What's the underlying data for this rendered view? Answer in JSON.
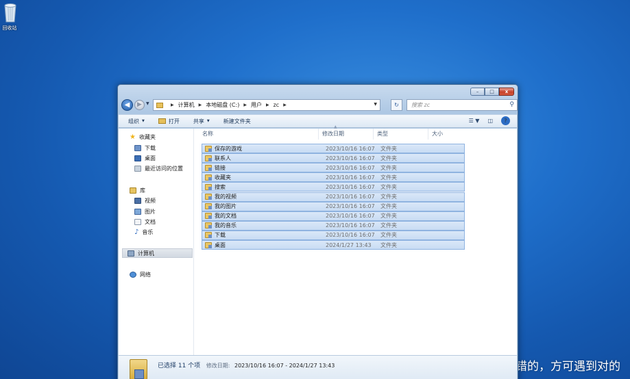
{
  "desktop": {
    "recycle_bin_label": "回收站",
    "watermark": "CSDN @告别错的，方可遇到对的"
  },
  "window": {
    "caption_buttons": {
      "minimize": "–",
      "maximize": "□",
      "close": "x"
    },
    "address": {
      "crumbs": [
        "计算机",
        "本地磁盘 (C:)",
        "用户",
        "zc"
      ]
    },
    "search_placeholder": "搜索 zc",
    "toolbar": {
      "organize": "组织",
      "open": "打开",
      "share": "共享",
      "new_folder": "新建文件夹"
    },
    "nav_pane": {
      "favorites": "收藏夹",
      "favorites_items": [
        "下载",
        "桌面",
        "最近访问的位置"
      ],
      "libraries": "库",
      "library_items": [
        "视频",
        "图片",
        "文档",
        "音乐"
      ],
      "computer": "计算机",
      "network": "网络"
    },
    "columns": [
      "名称",
      "修改日期",
      "类型",
      "大小"
    ],
    "files": [
      {
        "name": "保存的游戏",
        "date": "2023/10/16 16:07",
        "type": "文件夹"
      },
      {
        "name": "联系人",
        "date": "2023/10/16 16:07",
        "type": "文件夹"
      },
      {
        "name": "链接",
        "date": "2023/10/16 16:07",
        "type": "文件夹"
      },
      {
        "name": "收藏夹",
        "date": "2023/10/16 16:07",
        "type": "文件夹"
      },
      {
        "name": "搜索",
        "date": "2023/10/16 16:07",
        "type": "文件夹"
      },
      {
        "name": "我的视频",
        "date": "2023/10/16 16:07",
        "type": "文件夹"
      },
      {
        "name": "我的图片",
        "date": "2023/10/16 16:07",
        "type": "文件夹"
      },
      {
        "name": "我的文档",
        "date": "2023/10/16 16:07",
        "type": "文件夹"
      },
      {
        "name": "我的音乐",
        "date": "2023/10/16 16:07",
        "type": "文件夹"
      },
      {
        "name": "下载",
        "date": "2023/10/16 16:07",
        "type": "文件夹"
      },
      {
        "name": "桌面",
        "date": "2024/1/27 13:43",
        "type": "文件夹"
      }
    ],
    "details": {
      "selected": "已选择 11 个项",
      "modified_label": "修改日期:",
      "modified_value": "2023/10/16 16:07 - 2024/1/27 13:43"
    }
  }
}
